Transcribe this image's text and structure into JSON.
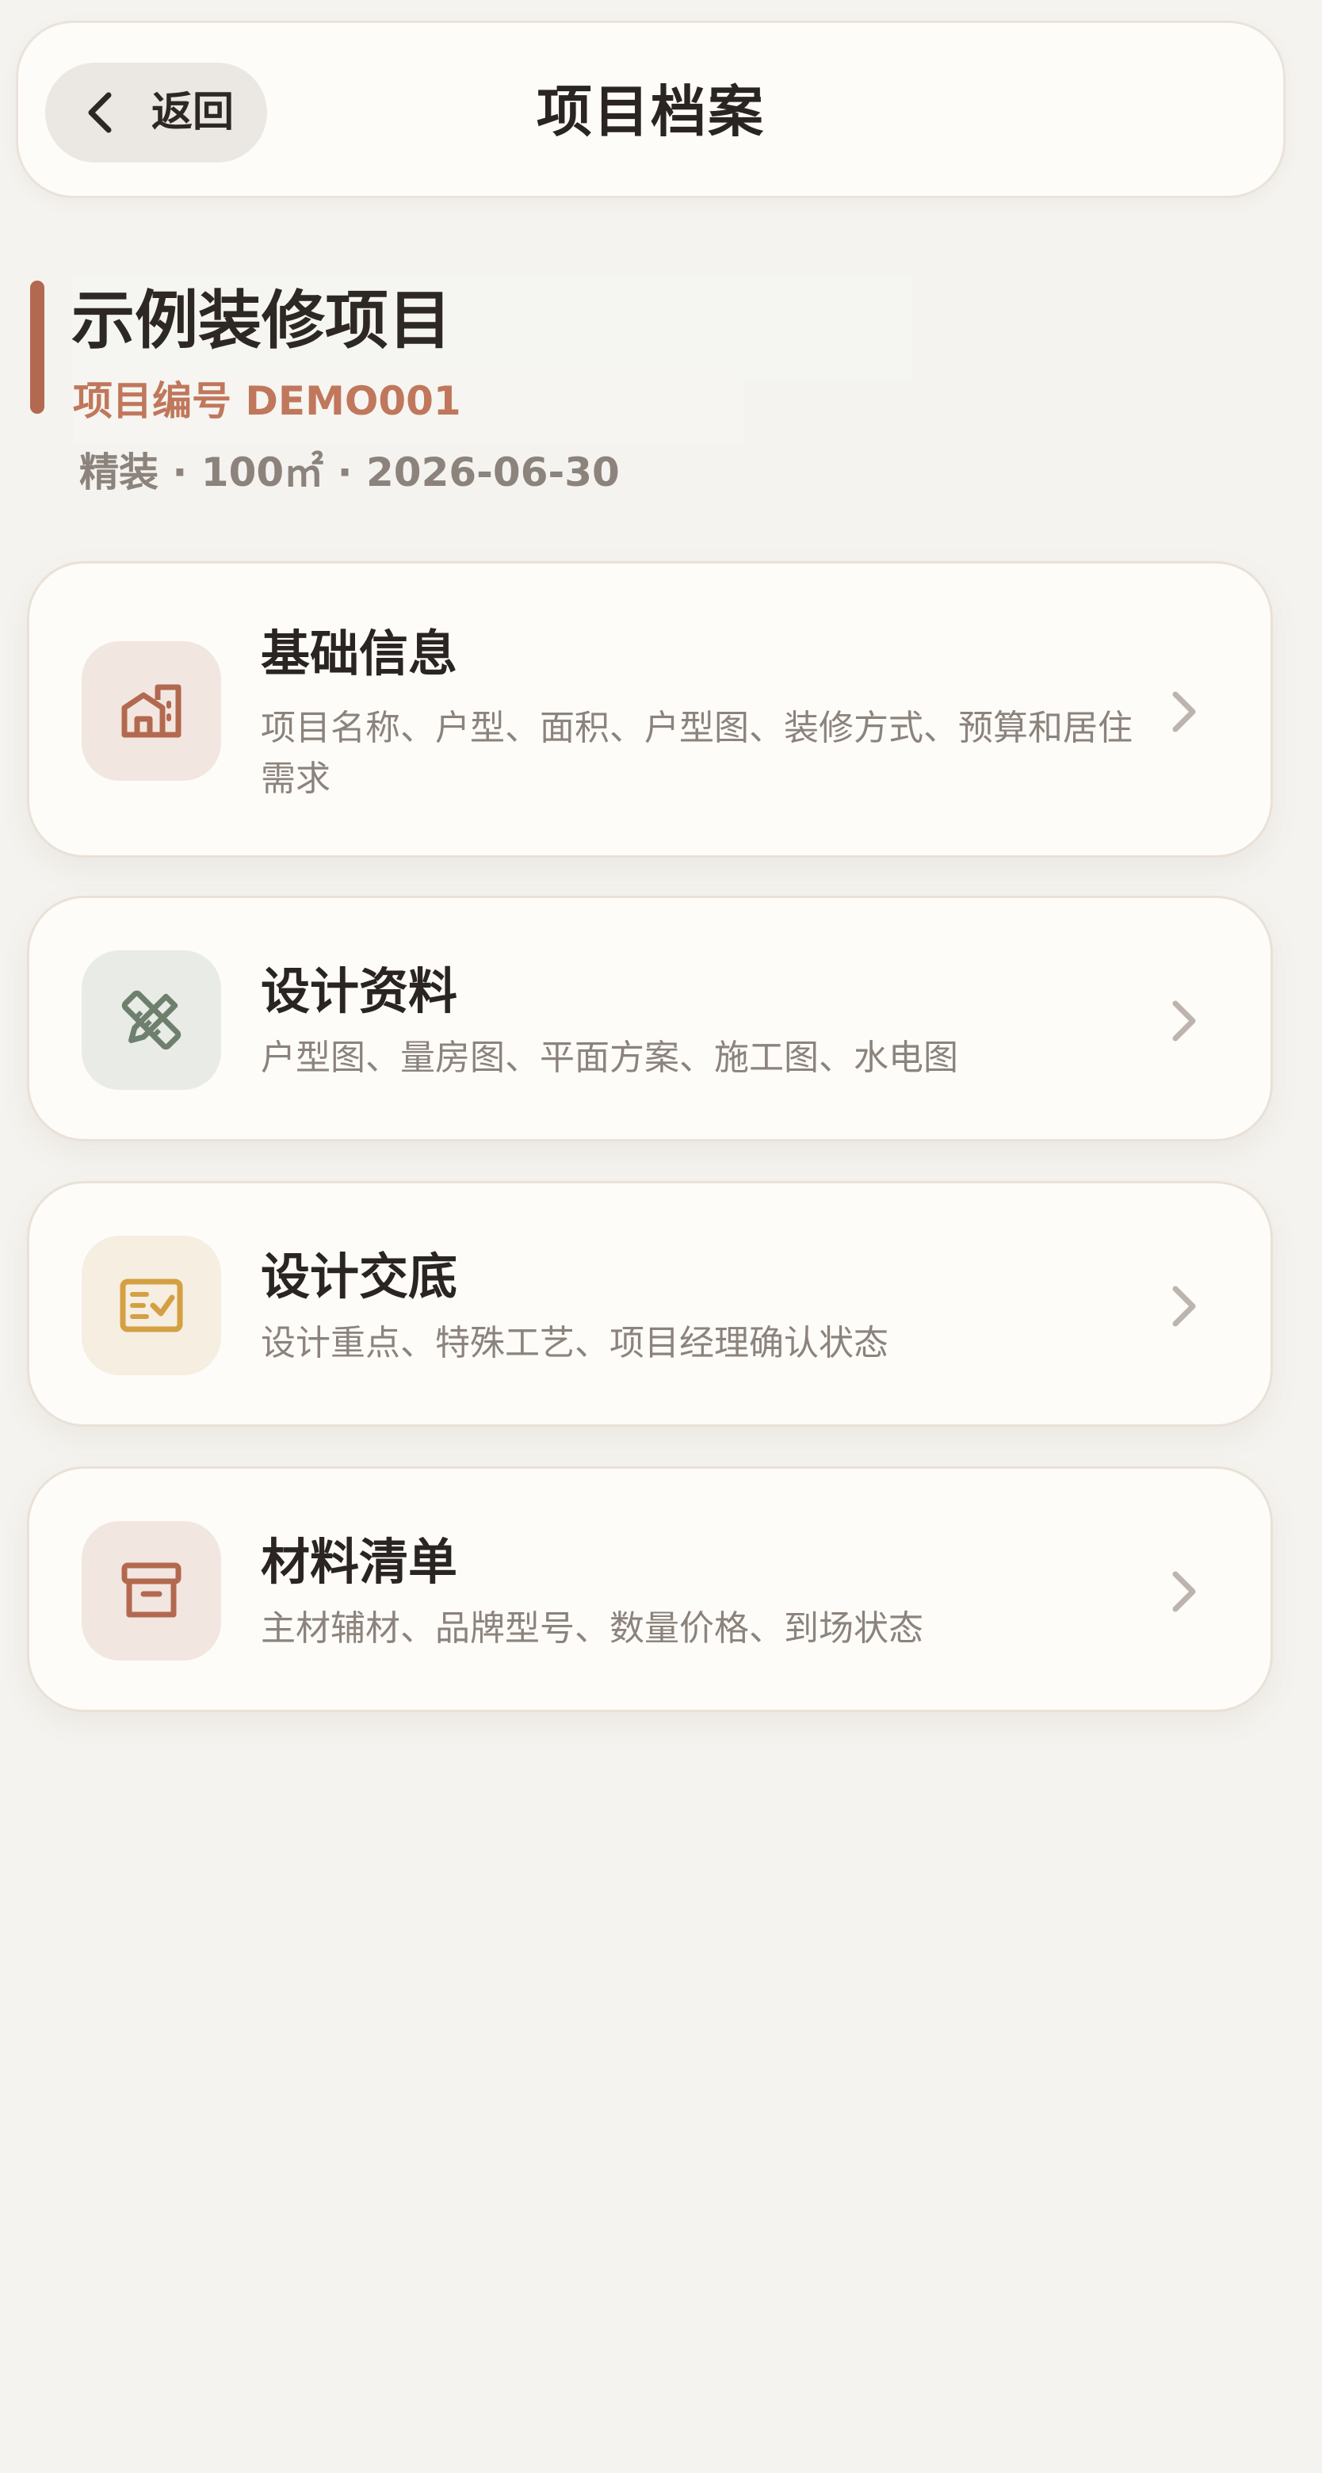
{
  "header": {
    "back_label": "返回",
    "title": "项目档案"
  },
  "project": {
    "name": "示例装修项目",
    "code": "项目编号 DEMO001",
    "meta": "精装 · 100㎡ · 2026-06-30"
  },
  "sections": [
    {
      "title": "基础信息",
      "description": "项目名称、户型、面积、户型图、装修方式、预算和居住需求",
      "icon": "home-icon",
      "color": "#b3694f"
    },
    {
      "title": "设计资料",
      "description": "户型图、量房图、平面方案、施工图、水电图",
      "icon": "ruler-pencil-icon",
      "color": "#6e7f6e"
    },
    {
      "title": "设计交底",
      "description": "设计重点、特殊工艺、项目经理确认状态",
      "icon": "checklist-icon",
      "color": "#d4a043"
    },
    {
      "title": "材料清单",
      "description": "主材辅材、品牌型号、数量价格、到场状态",
      "icon": "archive-box-icon",
      "color": "#b3694f"
    }
  ],
  "colors": {
    "background": "#f5f3ef",
    "card": "#fefcf9",
    "accent": "#b3694f",
    "muted_text": "#8b837c"
  }
}
